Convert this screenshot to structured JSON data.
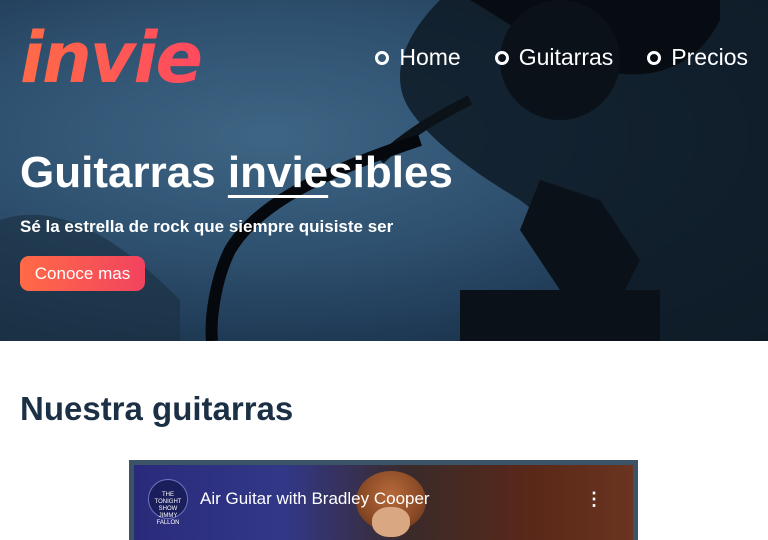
{
  "brand": {
    "logo_text": "invie"
  },
  "nav": {
    "items": [
      {
        "label": "Home"
      },
      {
        "label": "Guitarras"
      },
      {
        "label": "Precios"
      }
    ]
  },
  "hero": {
    "title_before": "Guitarras ",
    "title_underlined": "invie",
    "title_after": "sibles",
    "subtitle": "Sé la estrella de rock que siempre quisiste ser",
    "cta_label": "Conoce mas"
  },
  "section": {
    "title": "Nuestra guitarras"
  },
  "video": {
    "channel_badge": "THE TONIGHT SHOW JIMMY FALLON",
    "title": "Air Guitar with Bradley Cooper",
    "menu_icon": "more-vertical-icon"
  },
  "colors": {
    "accent": "#ff5a4e",
    "text_dark": "#1c3045",
    "hero_bg": "#2f5170"
  }
}
